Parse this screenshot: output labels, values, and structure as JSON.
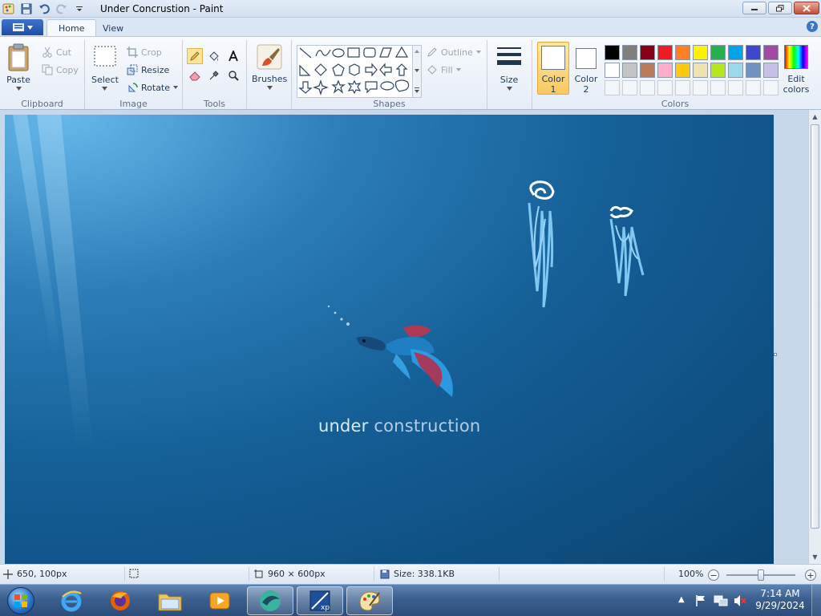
{
  "window": {
    "title": "Under Concrustion - Paint"
  },
  "tabs": [
    {
      "label": "Home"
    },
    {
      "label": "View"
    }
  ],
  "help_label": "?",
  "clipboard": {
    "group_label": "Clipboard",
    "paste": "Paste",
    "cut": "Cut",
    "copy": "Copy"
  },
  "image": {
    "group_label": "Image",
    "select": "Select",
    "crop": "Crop",
    "resize": "Resize",
    "rotate": "Rotate"
  },
  "tools": {
    "group_label": "Tools",
    "selected_tool": "pencil"
  },
  "brushes": {
    "label": "Brushes"
  },
  "shapes": {
    "group_label": "Shapes",
    "outline": "Outline",
    "fill": "Fill"
  },
  "size": {
    "label": "Size"
  },
  "colors": {
    "group_label": "Colors",
    "color1_line1": "Color",
    "color1_line2": "1",
    "color2_line1": "Color",
    "color2_line2": "2",
    "edit_line1": "Edit",
    "edit_line2": "colors",
    "color1_value": "#ffffff",
    "color2_value": "#ffffff",
    "palette_row1": [
      "#000000",
      "#7f7f7f",
      "#880015",
      "#ed1c24",
      "#ff7f27",
      "#fff200",
      "#22b14c",
      "#00a2e8",
      "#3f48cc",
      "#a349a4"
    ],
    "palette_row2": [
      "#ffffff",
      "#c3c3c3",
      "#b97a57",
      "#ffaec9",
      "#ffc90e",
      "#efe4b0",
      "#b5e61d",
      "#99d9ea",
      "#7092be",
      "#c8bfe7"
    ]
  },
  "canvas": {
    "text_bold": "under",
    "text_light": " construction"
  },
  "status": {
    "cursor_pos": "650, 100px",
    "dimensions": "960 × 600px",
    "size": "Size: 338.1KB",
    "zoom": "100%"
  },
  "taskbar": {
    "time": "7:14 AM",
    "date": "9/29/2024"
  }
}
